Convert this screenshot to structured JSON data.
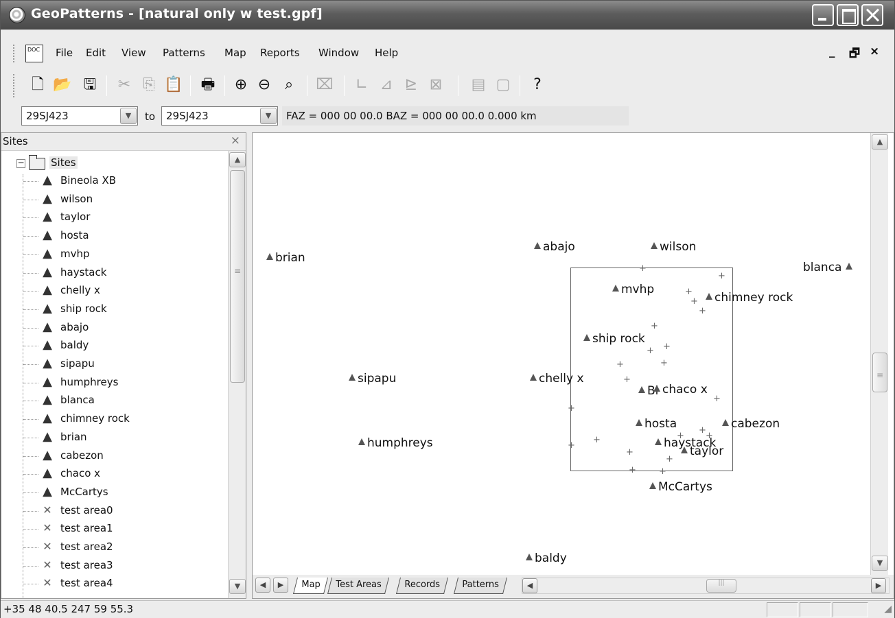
{
  "window": {
    "title": "GeoPatterns - [natural only w test.gpf]"
  },
  "menu": {
    "doc_icon": "DOC",
    "items": [
      "File",
      "Edit",
      "View",
      "Patterns",
      "Map",
      "Reports",
      "Window",
      "Help"
    ],
    "mdi_buttons": [
      "_",
      "🗗",
      "×"
    ]
  },
  "toolbar": {
    "icons": [
      "new-icon",
      "open-icon",
      "save-icon",
      "cut-icon",
      "copy-icon",
      "paste-icon",
      "print-icon",
      "zoom-in-icon",
      "zoom-out-icon",
      "zoom-fit-icon",
      "clear-icon",
      "tool1-icon",
      "tool2-icon",
      "tool3-icon",
      "tool4-icon",
      "report1-icon",
      "report2-icon",
      "help-icon"
    ]
  },
  "route": {
    "from": "29SJ423",
    "to_label": "to",
    "to": "29SJ423",
    "info": "FAZ = 000 00 00.0  BAZ = 000 00 00.0   0.000 km"
  },
  "sites_panel": {
    "title": "Sites",
    "root": "Sites",
    "items": [
      {
        "label": "Bineola XB",
        "type": "site"
      },
      {
        "label": "wilson",
        "type": "site"
      },
      {
        "label": "taylor",
        "type": "site"
      },
      {
        "label": "hosta",
        "type": "site"
      },
      {
        "label": "mvhp",
        "type": "site"
      },
      {
        "label": "haystack",
        "type": "site"
      },
      {
        "label": "chelly x",
        "type": "site"
      },
      {
        "label": "ship rock",
        "type": "site"
      },
      {
        "label": "abajo",
        "type": "site"
      },
      {
        "label": "baldy",
        "type": "site"
      },
      {
        "label": "sipapu",
        "type": "site"
      },
      {
        "label": "humphreys",
        "type": "site"
      },
      {
        "label": "blanca",
        "type": "site"
      },
      {
        "label": "chimney rock",
        "type": "site"
      },
      {
        "label": "brian",
        "type": "site"
      },
      {
        "label": "cabezon",
        "type": "site"
      },
      {
        "label": "chaco x",
        "type": "site"
      },
      {
        "label": "McCartys",
        "type": "site"
      },
      {
        "label": "test area0",
        "type": "test"
      },
      {
        "label": "test area1",
        "type": "test"
      },
      {
        "label": "test area2",
        "type": "test"
      },
      {
        "label": "test area3",
        "type": "test"
      },
      {
        "label": "test area4",
        "type": "test"
      }
    ]
  },
  "map": {
    "sites": {
      "brian": "brian",
      "abajo": "abajo",
      "wilson": "wilson",
      "blanca": "blanca",
      "mvhp": "mvhp",
      "chimney_rock": "chimney rock",
      "ship_rock": "ship rock",
      "sipapu": "sipapu",
      "chelly_x": "chelly x",
      "bineola": "Bi",
      "chaco_x": "chaco x",
      "hosta": "hosta",
      "cabezon": "cabezon",
      "humphreys": "humphreys",
      "haystack": "haystack",
      "taylor": "taylor",
      "mccartys": "McCartys",
      "baldy": "baldy"
    }
  },
  "tabs": [
    "Map",
    "Test Areas",
    "Records",
    "Patterns"
  ],
  "status": {
    "coords": "+35 48 40.5  247 59 55.3"
  }
}
